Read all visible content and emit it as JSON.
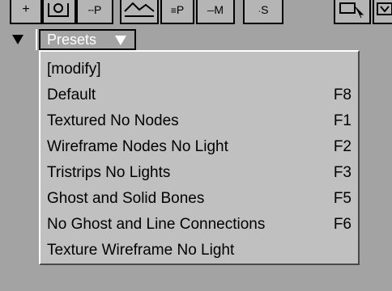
{
  "toolbar": {
    "items": [
      {
        "label": "+",
        "icon": "plus-icon"
      },
      {
        "label": "",
        "icon": "camera-icon"
      },
      {
        "label": "P",
        "icon": "nodes-p-icon"
      },
      {
        "label": "",
        "icon": "mountain-icon"
      },
      {
        "label": "P",
        "icon": "points-p-icon"
      },
      {
        "label": "M",
        "icon": "mesh-m-icon"
      },
      {
        "label": "S",
        "icon": "s-icon"
      },
      {
        "label": "",
        "icon": "cursor-icon"
      },
      {
        "label": "",
        "icon": "filter-icon"
      }
    ]
  },
  "presets": {
    "label": "Presets"
  },
  "menu": {
    "items": [
      {
        "label": "[modify]",
        "shortcut": ""
      },
      {
        "label": "Default",
        "shortcut": "F8"
      },
      {
        "label": "Textured No Nodes",
        "shortcut": "F1"
      },
      {
        "label": "Wireframe Nodes No Light",
        "shortcut": "F2"
      },
      {
        "label": "Tristrips No Lights",
        "shortcut": "F3"
      },
      {
        "label": "Ghost and Solid Bones",
        "shortcut": "F5"
      },
      {
        "label": "No Ghost and Line Connections",
        "shortcut": "F6"
      },
      {
        "label": "Texture Wireframe No Light",
        "shortcut": ""
      }
    ]
  },
  "colors": {
    "background": "#a3a3a3",
    "menu_bg": "#c0c0c0",
    "presets_text": "#ffffff"
  }
}
